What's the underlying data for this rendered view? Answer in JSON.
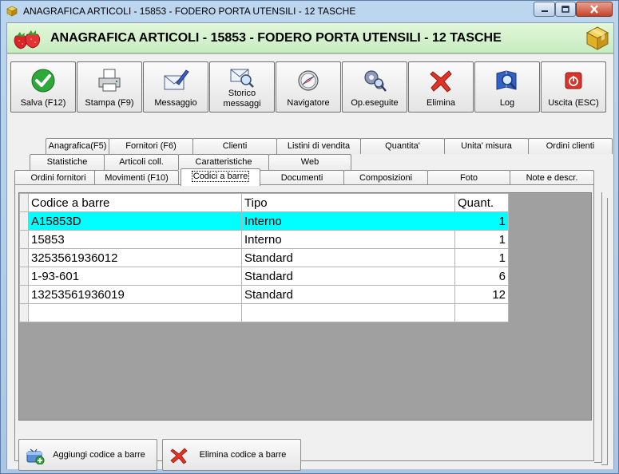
{
  "window": {
    "title": "ANAGRAFICA ARTICOLI - 15853 - FODERO PORTA UTENSILI - 12 TASCHE"
  },
  "header": {
    "title": "ANAGRAFICA ARTICOLI - 15853 - FODERO PORTA UTENSILI - 12 TASCHE"
  },
  "toolbar": {
    "save": "Salva (F12)",
    "print": "Stampa (F9)",
    "message": "Messaggio",
    "history_line1": "Storico",
    "history_line2": "messaggi",
    "navigator": "Navigatore",
    "ops_done": "Op.eseguite",
    "delete": "Elimina",
    "log": "Log",
    "exit": "Uscita (ESC)"
  },
  "tabs": {
    "row1": [
      "Anagrafica(F5)",
      "Fornitori (F6)",
      "Clienti",
      "Listini di vendita",
      "Quantita'",
      "Unita' misura",
      "Ordini clienti"
    ],
    "row2": [
      "Statistiche",
      "Articoli coll.",
      "Caratteristiche",
      "Web"
    ],
    "row3": [
      "Ordini fornitori",
      "Movimenti (F10)",
      "Codici a barre",
      "Documenti",
      "Composizioni",
      "Foto",
      "Note e descr."
    ]
  },
  "grid": {
    "columns": [
      "Codice a barre",
      "Tipo",
      "Quant."
    ],
    "rows": [
      [
        "A15853D",
        "Interno",
        "1"
      ],
      [
        "15853",
        "Interno",
        "1"
      ],
      [
        "3253561936012",
        "Standard",
        "1"
      ],
      [
        "1-93-601",
        "Standard",
        "6"
      ],
      [
        "13253561936019",
        "Standard",
        "12"
      ]
    ]
  },
  "actions": {
    "add": "Aggiungi codice a barre",
    "remove": "Elimina codice a barre"
  }
}
